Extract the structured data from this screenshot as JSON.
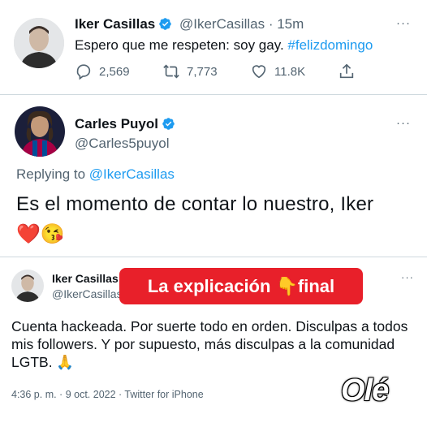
{
  "tweet1": {
    "name": "Iker Casillas",
    "handle": "@IkerCasillas",
    "time": "· 15m",
    "text_main": "Espero que me respeten: soy gay. ",
    "hashtag": "#felizdomingo",
    "replies": "2,569",
    "retweets": "7,773",
    "likes": "11.8K",
    "more": "···"
  },
  "tweet2": {
    "name": "Carles Puyol",
    "handle": "@Carles5puyol",
    "replying_prefix": "Replying to ",
    "replying_handle": "@IkerCasillas",
    "text": "Es el momento de contar lo nuestro, Iker",
    "emojis": "❤️😘",
    "more": "···"
  },
  "tweet3": {
    "name": "Iker Casillas",
    "handle": "@IkerCasillas",
    "text": "Cuenta hackeada. Por suerte todo en orden. Disculpas a todos mis followers. Y por supuesto, más disculpas a la comunidad LGTB. 🙏",
    "meta": "4:36 p. m. · 9 oct. 2022 · Twitter for iPhone",
    "more": "···"
  },
  "overlay": {
    "banner_text": "La explicación 👇final",
    "logo_text": "Olé"
  },
  "colors": {
    "accent": "#1d9bf0",
    "banner": "#e8202a",
    "muted": "#536471"
  },
  "icons": [
    "verified-icon",
    "reply-icon",
    "retweet-icon",
    "like-icon",
    "share-icon",
    "more-icon"
  ]
}
